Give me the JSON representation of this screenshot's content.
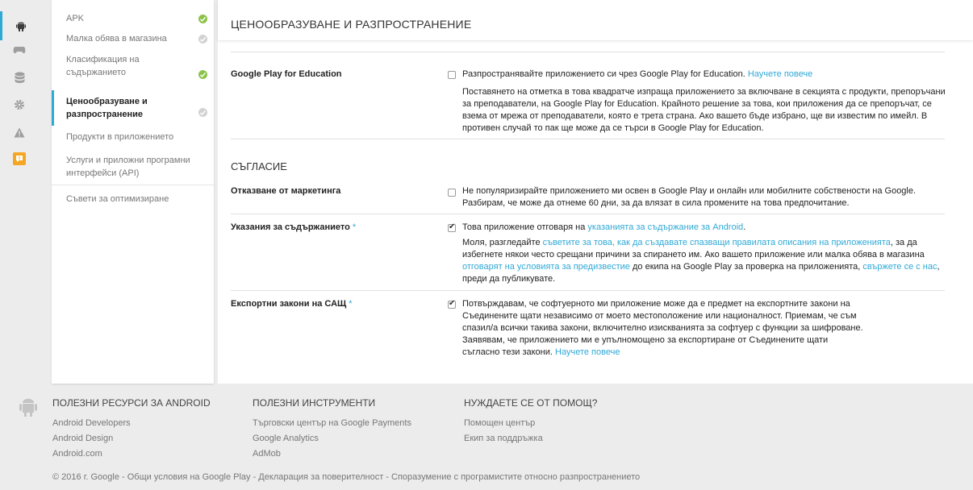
{
  "rail": {
    "items": [
      {
        "icon": "android-icon",
        "active": true
      },
      {
        "icon": "gamepad-icon"
      },
      {
        "icon": "database-icon"
      },
      {
        "icon": "gear-icon"
      },
      {
        "icon": "warning-icon"
      },
      {
        "icon": "speech-alert-icon",
        "color": "#f5a623"
      }
    ]
  },
  "sidebar": {
    "items": [
      {
        "label": "APK",
        "status": "ok"
      },
      {
        "label": "Малка обява в магазина",
        "status": "pending"
      },
      {
        "label": "Класификация на съдържанието",
        "status": "ok"
      },
      {
        "label": "Ценообразуване и разпространение",
        "status": "pending"
      },
      {
        "label": "Продукти в приложението"
      },
      {
        "label": "Услуги и приложни програмни интерфейси (API)"
      },
      {
        "label": "Съвети за оптимизиране"
      }
    ]
  },
  "main": {
    "title": "ЦЕНООБРАЗУВАНЕ И РАЗПРОСТРАНЕНИЕ",
    "education": {
      "label": "Google Play for Education",
      "checkbox_text": "Разпространявайте приложението си чрез Google Play for Education.",
      "learn_more": "Научете повече",
      "description": "Поставянето на отметка в това квадратче изпраща приложението за включване в секцията с продукти, препоръчани за преподаватели, на Google Play for Education. Крайното решение за това, кои приложения да се препоръчат, се взема от мрежа от преподаватели, която е трета страна. Ако вашето бъде избрано, ще ви известим по имейл. В противен случай то пак ще може да се търси в Google Play for Education.",
      "checked": false
    },
    "consent_title": "СЪГЛАСИЕ",
    "marketing": {
      "label": "Отказване от маркетинга",
      "text": "Не популяризирайте приложението ми освен в Google Play и онлайн или мобилните собствености на Google. Разбирам, че може да отнеме 60 дни, за да влязат в сила промените на това предпочитание.",
      "checked": false
    },
    "guidelines": {
      "label": "Указания за съдържанието",
      "required": "*",
      "text_before": "Това приложение отговаря на ",
      "link": "указанията за съдържание за Android",
      "text_after": ".",
      "p2_a": "Моля, разгледайте ",
      "p2_link1": "съветите за това, как да създавате спазващи правилата описания на приложенията",
      "p2_b": ", за да избегнете някои често срещани причини за спирането им. Ако вашето приложение или малка обява в магазина ",
      "p2_link2": "отговарят на условията за предизвестие",
      "p2_c": " до екипа на Google Play за проверка на приложенията, ",
      "p2_link3": "свържете се с нас",
      "p2_d": ", преди да публикувате.",
      "checked": true
    },
    "export": {
      "label": "Експортни закони на САЩ",
      "required": "*",
      "text": "Потвърждавам, че софтуерното ми приложение може да е предмет на експортните закони на Съединените щати независимо от моето местоположение или националност. Приемам, че съм спазил/а всички такива закони, включително изискванията за софтуер с функции за шифроване. Заявявам, че приложението ми е упълномощено за експортиране от Съединените щати съгласно тези закони.",
      "learn_more": "Научете повече",
      "checked": true
    }
  },
  "footer": {
    "col1": {
      "title": "ПОЛЕЗНИ РЕСУРСИ ЗА ANDROID",
      "links": [
        "Android Developers",
        "Android Design",
        "Android.com"
      ]
    },
    "col2": {
      "title": "ПОЛЕЗНИ ИНСТРУМЕНТИ",
      "links": [
        "Търговски център на Google Payments",
        "Google Analytics",
        "AdMob"
      ]
    },
    "col3": {
      "title": "НУЖДАЕТЕ СЕ ОТ ПОМОЩ?",
      "links": [
        "Помощен център",
        "Екип за поддръжка"
      ]
    },
    "copyright": "© 2016 г. Google - Общи условия на Google Play - Декларация за поверителност - Споразумение с програмистите относно разпространението"
  },
  "colors": {
    "accent": "#2fa9d6",
    "ok": "#8bc34a",
    "pending": "#d2d2d2",
    "alert": "#f5a623"
  }
}
